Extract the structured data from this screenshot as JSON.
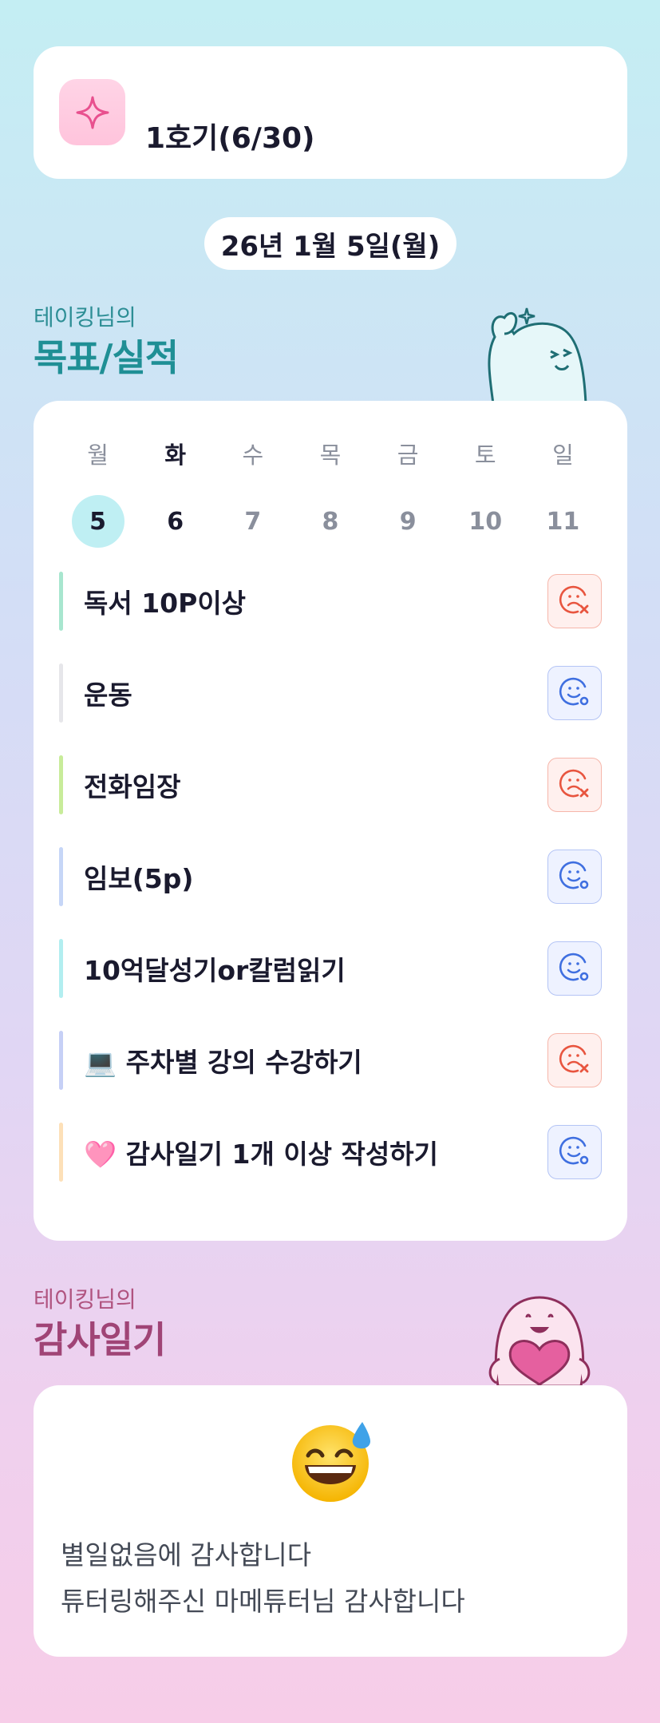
{
  "cohort": {
    "icon": "sparkle-icon",
    "title": "1호기(6/30)"
  },
  "date_label": "26년 1월 5일(월)",
  "goals_section": {
    "subtitle": "테이킹님의",
    "title": "목표/실적"
  },
  "week": {
    "days": [
      {
        "name": "월",
        "num": "5",
        "state": "today"
      },
      {
        "name": "화",
        "num": "6",
        "state": "dark"
      },
      {
        "name": "수",
        "num": "7",
        "state": "muted"
      },
      {
        "name": "목",
        "num": "8",
        "state": "muted"
      },
      {
        "name": "금",
        "num": "9",
        "state": "muted"
      },
      {
        "name": "토",
        "num": "10",
        "state": "muted"
      },
      {
        "name": "일",
        "num": "11",
        "state": "muted"
      }
    ]
  },
  "goals": [
    {
      "label": "독서 10P이상",
      "bar_color": "#a8e6cf",
      "status": "fail",
      "icon": "sad-face-x-icon"
    },
    {
      "label": "운동",
      "bar_color": "#e6e6ea",
      "status": "done",
      "icon": "smile-face-check-icon"
    },
    {
      "label": "전화임장",
      "bar_color": "#c8ec9a",
      "status": "fail",
      "icon": "sad-face-x-icon"
    },
    {
      "label": "임보(5p)",
      "bar_color": "#c6d6f7",
      "status": "done",
      "icon": "smile-face-check-icon"
    },
    {
      "label": "10억달성기or칼럼읽기",
      "bar_color": "#b2eef0",
      "status": "done",
      "icon": "smile-face-check-icon"
    },
    {
      "label": "💻 주차별 강의 수강하기",
      "bar_color": "#c6d0f6",
      "status": "fail",
      "icon": "sad-face-x-icon"
    },
    {
      "label": "🩷 감사일기 1개 이상 작성하기",
      "bar_color": "#fde0b8",
      "status": "done",
      "icon": "smile-face-check-icon"
    }
  ],
  "thanks_section": {
    "subtitle": "테이킹님의",
    "title": "감사일기"
  },
  "thanks_card": {
    "emoji": "grinning-sweat-emoji",
    "lines": [
      "별일없음에 감사합니다",
      "튜터링해주신 마메튜터님 감사합니다"
    ]
  },
  "colors": {
    "accent_teal": "#1f8f95",
    "accent_pink": "#a04476",
    "fail": "#e8553f",
    "done": "#3f6fe0"
  }
}
